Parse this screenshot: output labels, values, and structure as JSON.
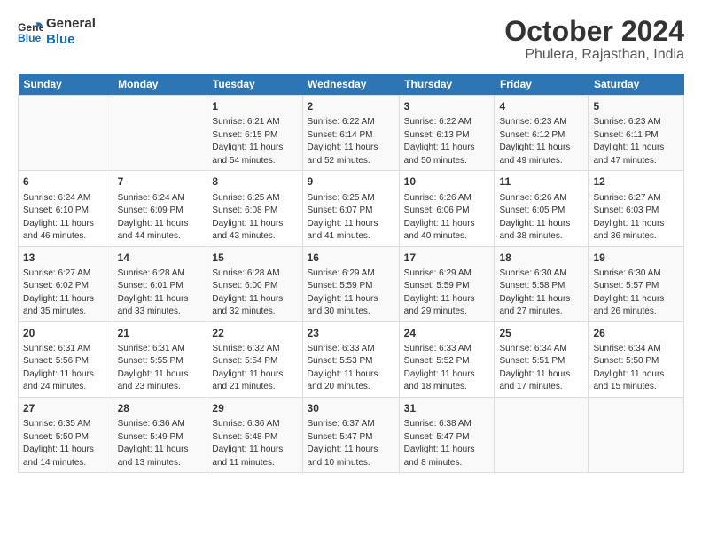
{
  "logo": {
    "line1": "General",
    "line2": "Blue"
  },
  "title": "October 2024",
  "subtitle": "Phulera, Rajasthan, India",
  "days_of_week": [
    "Sunday",
    "Monday",
    "Tuesday",
    "Wednesday",
    "Thursday",
    "Friday",
    "Saturday"
  ],
  "weeks": [
    [
      {
        "day": "",
        "sunrise": "",
        "sunset": "",
        "daylight": ""
      },
      {
        "day": "",
        "sunrise": "",
        "sunset": "",
        "daylight": ""
      },
      {
        "day": "1",
        "sunrise": "Sunrise: 6:21 AM",
        "sunset": "Sunset: 6:15 PM",
        "daylight": "Daylight: 11 hours and 54 minutes."
      },
      {
        "day": "2",
        "sunrise": "Sunrise: 6:22 AM",
        "sunset": "Sunset: 6:14 PM",
        "daylight": "Daylight: 11 hours and 52 minutes."
      },
      {
        "day": "3",
        "sunrise": "Sunrise: 6:22 AM",
        "sunset": "Sunset: 6:13 PM",
        "daylight": "Daylight: 11 hours and 50 minutes."
      },
      {
        "day": "4",
        "sunrise": "Sunrise: 6:23 AM",
        "sunset": "Sunset: 6:12 PM",
        "daylight": "Daylight: 11 hours and 49 minutes."
      },
      {
        "day": "5",
        "sunrise": "Sunrise: 6:23 AM",
        "sunset": "Sunset: 6:11 PM",
        "daylight": "Daylight: 11 hours and 47 minutes."
      }
    ],
    [
      {
        "day": "6",
        "sunrise": "Sunrise: 6:24 AM",
        "sunset": "Sunset: 6:10 PM",
        "daylight": "Daylight: 11 hours and 46 minutes."
      },
      {
        "day": "7",
        "sunrise": "Sunrise: 6:24 AM",
        "sunset": "Sunset: 6:09 PM",
        "daylight": "Daylight: 11 hours and 44 minutes."
      },
      {
        "day": "8",
        "sunrise": "Sunrise: 6:25 AM",
        "sunset": "Sunset: 6:08 PM",
        "daylight": "Daylight: 11 hours and 43 minutes."
      },
      {
        "day": "9",
        "sunrise": "Sunrise: 6:25 AM",
        "sunset": "Sunset: 6:07 PM",
        "daylight": "Daylight: 11 hours and 41 minutes."
      },
      {
        "day": "10",
        "sunrise": "Sunrise: 6:26 AM",
        "sunset": "Sunset: 6:06 PM",
        "daylight": "Daylight: 11 hours and 40 minutes."
      },
      {
        "day": "11",
        "sunrise": "Sunrise: 6:26 AM",
        "sunset": "Sunset: 6:05 PM",
        "daylight": "Daylight: 11 hours and 38 minutes."
      },
      {
        "day": "12",
        "sunrise": "Sunrise: 6:27 AM",
        "sunset": "Sunset: 6:03 PM",
        "daylight": "Daylight: 11 hours and 36 minutes."
      }
    ],
    [
      {
        "day": "13",
        "sunrise": "Sunrise: 6:27 AM",
        "sunset": "Sunset: 6:02 PM",
        "daylight": "Daylight: 11 hours and 35 minutes."
      },
      {
        "day": "14",
        "sunrise": "Sunrise: 6:28 AM",
        "sunset": "Sunset: 6:01 PM",
        "daylight": "Daylight: 11 hours and 33 minutes."
      },
      {
        "day": "15",
        "sunrise": "Sunrise: 6:28 AM",
        "sunset": "Sunset: 6:00 PM",
        "daylight": "Daylight: 11 hours and 32 minutes."
      },
      {
        "day": "16",
        "sunrise": "Sunrise: 6:29 AM",
        "sunset": "Sunset: 5:59 PM",
        "daylight": "Daylight: 11 hours and 30 minutes."
      },
      {
        "day": "17",
        "sunrise": "Sunrise: 6:29 AM",
        "sunset": "Sunset: 5:59 PM",
        "daylight": "Daylight: 11 hours and 29 minutes."
      },
      {
        "day": "18",
        "sunrise": "Sunrise: 6:30 AM",
        "sunset": "Sunset: 5:58 PM",
        "daylight": "Daylight: 11 hours and 27 minutes."
      },
      {
        "day": "19",
        "sunrise": "Sunrise: 6:30 AM",
        "sunset": "Sunset: 5:57 PM",
        "daylight": "Daylight: 11 hours and 26 minutes."
      }
    ],
    [
      {
        "day": "20",
        "sunrise": "Sunrise: 6:31 AM",
        "sunset": "Sunset: 5:56 PM",
        "daylight": "Daylight: 11 hours and 24 minutes."
      },
      {
        "day": "21",
        "sunrise": "Sunrise: 6:31 AM",
        "sunset": "Sunset: 5:55 PM",
        "daylight": "Daylight: 11 hours and 23 minutes."
      },
      {
        "day": "22",
        "sunrise": "Sunrise: 6:32 AM",
        "sunset": "Sunset: 5:54 PM",
        "daylight": "Daylight: 11 hours and 21 minutes."
      },
      {
        "day": "23",
        "sunrise": "Sunrise: 6:33 AM",
        "sunset": "Sunset: 5:53 PM",
        "daylight": "Daylight: 11 hours and 20 minutes."
      },
      {
        "day": "24",
        "sunrise": "Sunrise: 6:33 AM",
        "sunset": "Sunset: 5:52 PM",
        "daylight": "Daylight: 11 hours and 18 minutes."
      },
      {
        "day": "25",
        "sunrise": "Sunrise: 6:34 AM",
        "sunset": "Sunset: 5:51 PM",
        "daylight": "Daylight: 11 hours and 17 minutes."
      },
      {
        "day": "26",
        "sunrise": "Sunrise: 6:34 AM",
        "sunset": "Sunset: 5:50 PM",
        "daylight": "Daylight: 11 hours and 15 minutes."
      }
    ],
    [
      {
        "day": "27",
        "sunrise": "Sunrise: 6:35 AM",
        "sunset": "Sunset: 5:50 PM",
        "daylight": "Daylight: 11 hours and 14 minutes."
      },
      {
        "day": "28",
        "sunrise": "Sunrise: 6:36 AM",
        "sunset": "Sunset: 5:49 PM",
        "daylight": "Daylight: 11 hours and 13 minutes."
      },
      {
        "day": "29",
        "sunrise": "Sunrise: 6:36 AM",
        "sunset": "Sunset: 5:48 PM",
        "daylight": "Daylight: 11 hours and 11 minutes."
      },
      {
        "day": "30",
        "sunrise": "Sunrise: 6:37 AM",
        "sunset": "Sunset: 5:47 PM",
        "daylight": "Daylight: 11 hours and 10 minutes."
      },
      {
        "day": "31",
        "sunrise": "Sunrise: 6:38 AM",
        "sunset": "Sunset: 5:47 PM",
        "daylight": "Daylight: 11 hours and 8 minutes."
      },
      {
        "day": "",
        "sunrise": "",
        "sunset": "",
        "daylight": ""
      },
      {
        "day": "",
        "sunrise": "",
        "sunset": "",
        "daylight": ""
      }
    ]
  ]
}
